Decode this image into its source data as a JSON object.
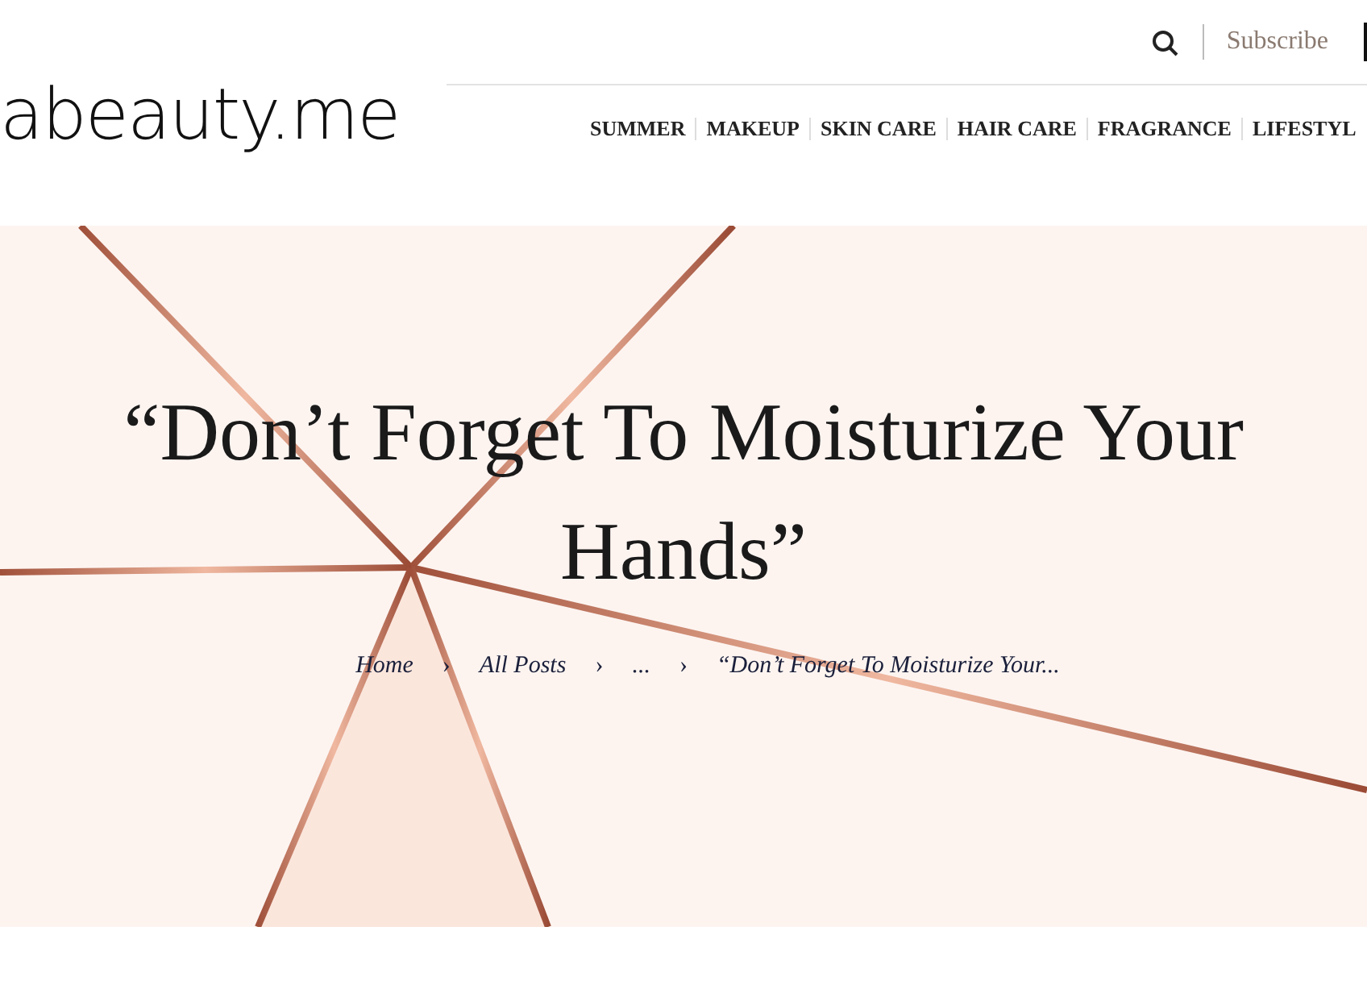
{
  "logo": "abeauty.me",
  "header": {
    "subscribe": "Subscribe"
  },
  "nav": [
    "SUMMER",
    "MAKEUP",
    "SKIN CARE",
    "HAIR CARE",
    "FRAGRANCE",
    "LIFESTYL"
  ],
  "hero": {
    "title": "“Don’t Forget To Moisturize Your Hands”",
    "breadcrumb_separator": "›",
    "breadcrumb": [
      "Home",
      "All Posts",
      "...",
      "“Don’t Forget To Moisturize Your..."
    ]
  }
}
